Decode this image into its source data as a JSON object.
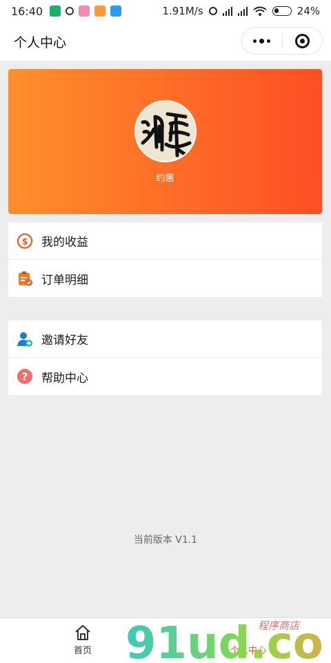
{
  "status_bar": {
    "time": "16:40",
    "network_speed": "1.91M/s",
    "battery_percent": "24%"
  },
  "nav": {
    "title": "个人中心"
  },
  "profile": {
    "username": "约惠",
    "avatar_text": "消惠"
  },
  "menu_group_1": [
    {
      "label": "我的收益",
      "icon": "income-icon"
    },
    {
      "label": "订单明细",
      "icon": "order-icon"
    }
  ],
  "menu_group_2": [
    {
      "label": "邀请好友",
      "icon": "invite-friend-icon"
    },
    {
      "label": "帮助中心",
      "icon": "help-icon"
    }
  ],
  "version_text": "当前版本 V1.1",
  "tab_bar": {
    "home_label": "首页",
    "me_label": "个人中心"
  },
  "watermark": {
    "text": "91ud.com",
    "sub": "程序商店"
  },
  "colors": {
    "gradient_start": "#ff8f2c",
    "gradient_end": "#ff4e24",
    "active_tab": "#ff5a1f"
  }
}
